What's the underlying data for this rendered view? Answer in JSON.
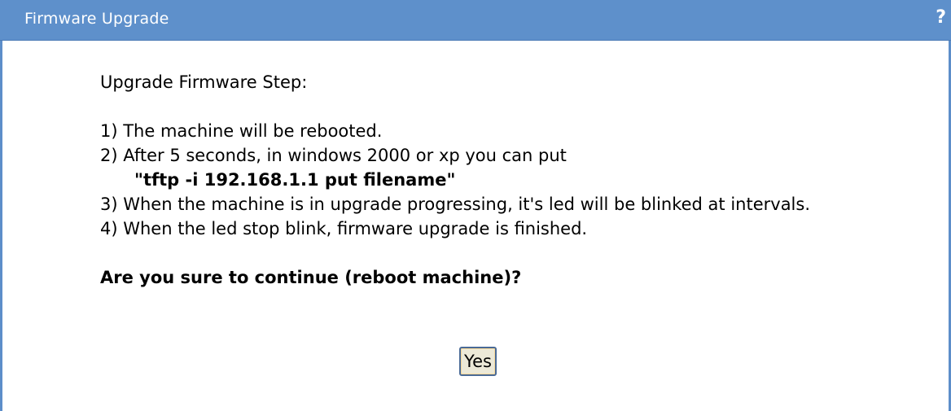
{
  "window": {
    "title": "Firmware Upgrade",
    "help_icon": "?"
  },
  "instructions": {
    "heading": "Upgrade Firmware Step:",
    "step1": "1) The machine will be rebooted.",
    "step2": "2) After 5 seconds, in windows 2000 or xp you can put",
    "step2_command": "\"tftp -i 192.168.1.1 put filename\"",
    "step3": "3) When the machine is in upgrade progressing, it's led will be blinked at intervals.",
    "step4": "4) When the led stop blink, firmware upgrade is finished."
  },
  "confirm": {
    "question": "Are you sure to continue (reboot machine)?",
    "yes_label": "Yes"
  },
  "colors": {
    "titlebar": "#5e90cb",
    "border": "#5d8ec9"
  }
}
